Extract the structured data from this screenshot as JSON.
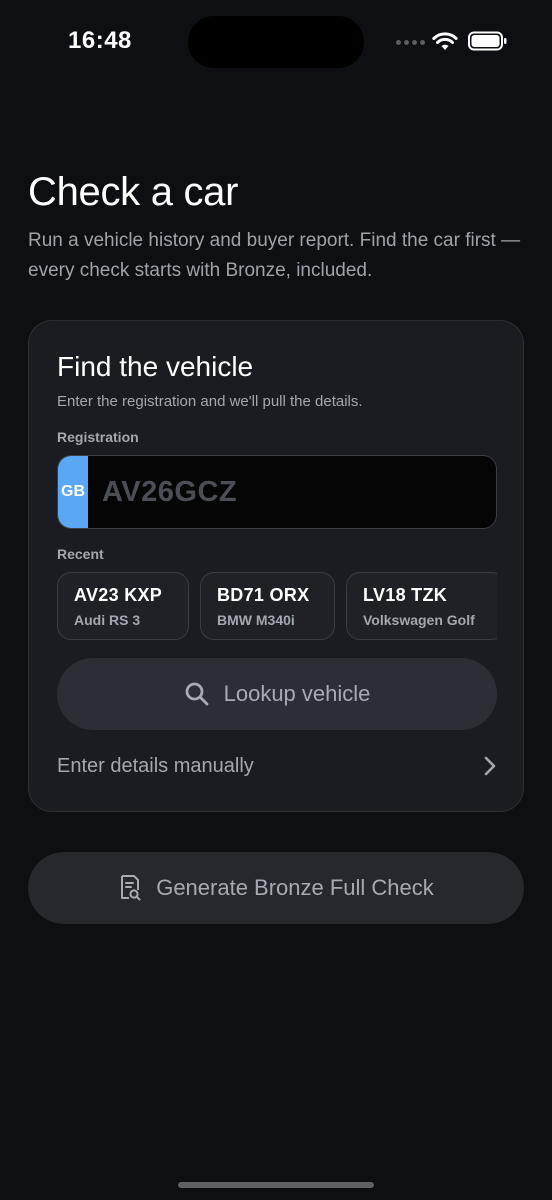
{
  "status_bar": {
    "time": "16:48"
  },
  "header": {
    "title": "Check a car",
    "subtitle": "Run a vehicle history and buyer report. Find the car first — every check starts with Bronze, included."
  },
  "find_vehicle": {
    "title": "Find the vehicle",
    "subtitle": "Enter the registration and we'll pull the details.",
    "registration_label": "Registration",
    "country_badge": "GB",
    "registration_value": "",
    "registration_placeholder": "AV26GCZ",
    "recent_label": "Recent",
    "recent": [
      {
        "reg": "AV23 KXP",
        "model": "Audi RS 3"
      },
      {
        "reg": "BD71 ORX",
        "model": "BMW M340i"
      },
      {
        "reg": "LV18 TZK",
        "model": "Volkswagen Golf"
      }
    ],
    "lookup_label": "Lookup vehicle",
    "manual_label": "Enter details manually"
  },
  "generate_label": "Generate Bronze Full Check",
  "icons": {
    "lookup": "search-icon",
    "manual": "chevron-right-icon",
    "generate": "document-search-icon"
  },
  "colors": {
    "background": "#0e0f12",
    "card": "#1a1c21",
    "plate_badge": "#5aa8f5"
  }
}
